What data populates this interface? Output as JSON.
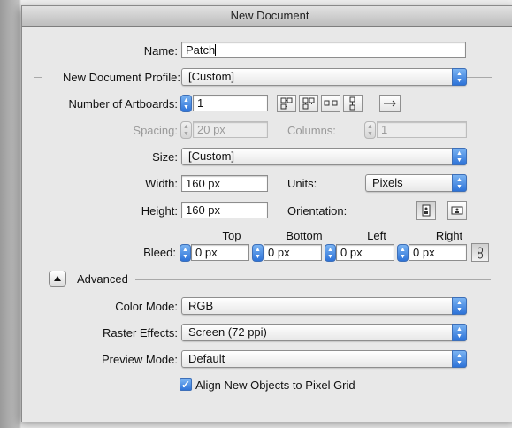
{
  "window": {
    "title": "New Document"
  },
  "name": {
    "label": "Name:",
    "value": "Patch"
  },
  "profile": {
    "label": "New Document Profile:",
    "value": "[Custom]"
  },
  "artboards": {
    "label": "Number of Artboards:",
    "value": "1"
  },
  "spacing": {
    "label": "Spacing:",
    "value": "20 px"
  },
  "columns": {
    "label": "Columns:",
    "value": "1"
  },
  "size": {
    "label": "Size:",
    "value": "[Custom]"
  },
  "width": {
    "label": "Width:",
    "value": "160 px"
  },
  "units": {
    "label": "Units:",
    "value": "Pixels"
  },
  "height": {
    "label": "Height:",
    "value": "160 px"
  },
  "orientation": {
    "label": "Orientation:",
    "selected": "portrait"
  },
  "bleed": {
    "label": "Bleed:",
    "top_label": "Top",
    "top_value": "0 px",
    "bottom_label": "Bottom",
    "bottom_value": "0 px",
    "left_label": "Left",
    "left_value": "0 px",
    "right_label": "Right",
    "right_value": "0 px"
  },
  "advanced": {
    "label": "Advanced",
    "expanded": true
  },
  "color_mode": {
    "label": "Color Mode:",
    "value": "RGB"
  },
  "raster_effects": {
    "label": "Raster Effects:",
    "value": "Screen (72 ppi)"
  },
  "preview_mode": {
    "label": "Preview Mode:",
    "value": "Default"
  },
  "pixel_grid": {
    "label": "Align New Objects to Pixel Grid",
    "checked": true
  },
  "colors": {
    "accent": "#2e73d8",
    "window_bg": "#e8e8e8"
  }
}
